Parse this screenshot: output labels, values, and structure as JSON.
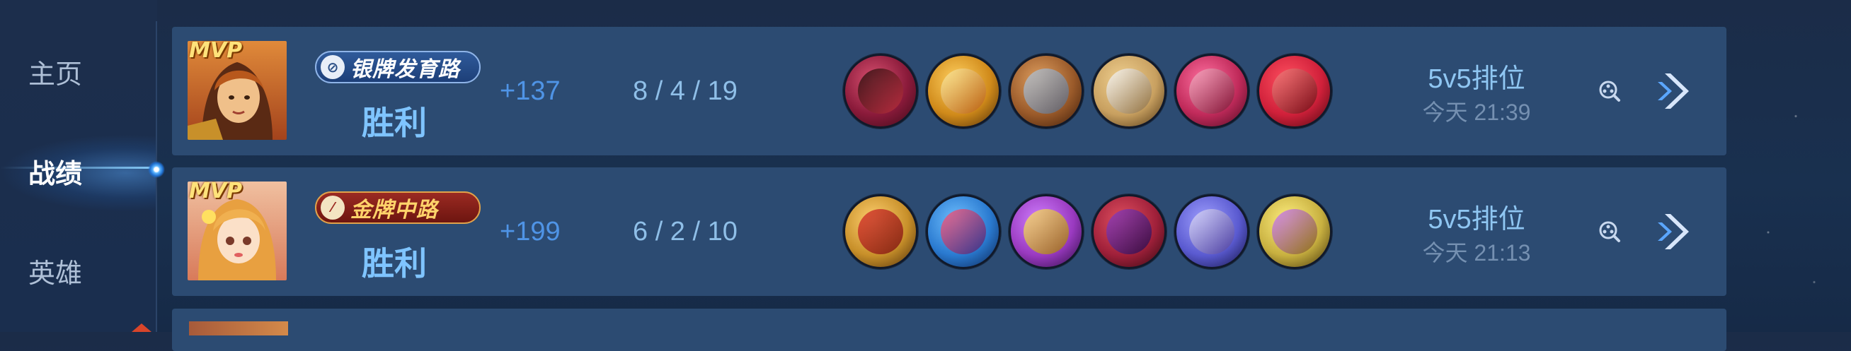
{
  "sidebar": {
    "items": [
      {
        "label": "主页",
        "active": false
      },
      {
        "label": "战绩",
        "active": true
      },
      {
        "label": "英雄",
        "active": false
      }
    ]
  },
  "matches": [
    {
      "mvp": "MVP",
      "hero_icon": "hero-portrait-warrior",
      "badge": {
        "type": "silver",
        "text": "银牌发育路",
        "icon": "lane-icon"
      },
      "result": "胜利",
      "score": "+137",
      "kda": "8 / 4 / 19",
      "items": [
        {
          "icon": "item-icon-1",
          "color": "#8a1a3a"
        },
        {
          "icon": "item-icon-2",
          "color": "#d08a1a"
        },
        {
          "icon": "item-icon-3",
          "color": "#9a5a2a"
        },
        {
          "icon": "item-icon-4",
          "color": "#c8a060"
        },
        {
          "icon": "item-icon-5",
          "color": "#c02a5a"
        },
        {
          "icon": "item-icon-6",
          "color": "#d0203a"
        }
      ],
      "mode": "5v5排位",
      "time": "今天 21:39"
    },
    {
      "mvp": "MVP",
      "hero_icon": "hero-portrait-mage",
      "badge": {
        "type": "gold",
        "text": "金牌中路",
        "icon": "lane-icon"
      },
      "result": "胜利",
      "score": "+199",
      "kda": "6 / 2 / 10",
      "items": [
        {
          "icon": "item-icon-1",
          "color": "#c8902a"
        },
        {
          "icon": "item-icon-2",
          "color": "#2a7ad0"
        },
        {
          "icon": "item-icon-3",
          "color": "#9a3ac0"
        },
        {
          "icon": "item-icon-4",
          "color": "#a0203a"
        },
        {
          "icon": "item-icon-5",
          "color": "#5a5ad0"
        },
        {
          "icon": "item-icon-6",
          "color": "#c8b040"
        }
      ],
      "mode": "5v5排位",
      "time": "今天 21:13"
    }
  ]
}
